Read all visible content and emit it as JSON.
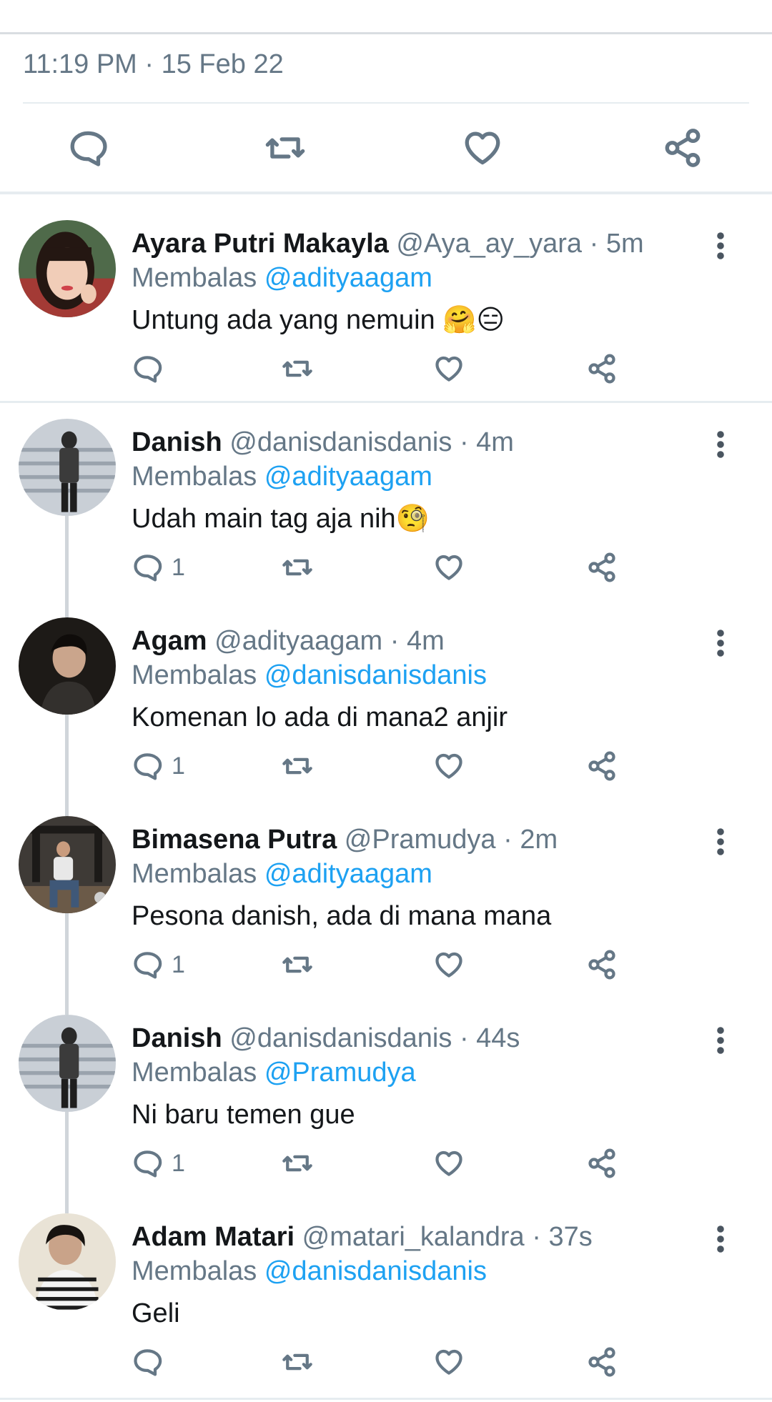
{
  "tweet": {
    "timestamp": "11:19 PM · 15 Feb 22",
    "actions": [
      {
        "name": "reply-icon"
      },
      {
        "name": "retweet-icon"
      },
      {
        "name": "like-icon"
      },
      {
        "name": "share-icon"
      }
    ]
  },
  "colors": {
    "accent": "#1da1f2",
    "muted": "#657786",
    "text": "#14171a",
    "divider": "#e6ecf0"
  },
  "replies": [
    {
      "name": "Ayara Putri Makayla",
      "handle": "@Aya_ay_yara",
      "time": "5m",
      "replying_label": "Membalas",
      "replying_to": "@adityaagam",
      "text": "Untung ada yang nemuin 🤗😑",
      "reply_count": "",
      "avatar": "avatar-girl-green-bg"
    },
    {
      "name": "Danish",
      "handle": "@danisdanisdanis",
      "time": "4m",
      "replying_label": "Membalas",
      "replying_to": "@adityaagam",
      "text": "Udah main tag aja nih🧐",
      "reply_count": "1",
      "avatar": "avatar-man-standing"
    },
    {
      "name": "Agam",
      "handle": "@adityaagam",
      "time": "4m",
      "replying_label": "Membalas",
      "replying_to": "@danisdanisdanis",
      "text": "Komenan lo ada di mana2 anjir",
      "reply_count": "1",
      "avatar": "avatar-man-dark"
    },
    {
      "name": "Bimasena Putra",
      "handle": "@Pramudya",
      "time": "2m",
      "replying_label": "Membalas",
      "replying_to": "@adityaagam",
      "text": "Pesona danish, ada di mana mana",
      "reply_count": "1",
      "avatar": "avatar-man-sitting"
    },
    {
      "name": "Danish",
      "handle": "@danisdanisdanis",
      "time": "44s",
      "replying_label": "Membalas",
      "replying_to": "@Pramudya",
      "text": "Ni baru temen gue",
      "reply_count": "1",
      "avatar": "avatar-man-standing"
    },
    {
      "name": "Adam Matari",
      "handle": "@matari_kalandra",
      "time": "37s",
      "replying_label": "Membalas",
      "replying_to": "@danisdanisdanis",
      "text": "Geli",
      "reply_count": "",
      "avatar": "avatar-man-striped"
    }
  ]
}
